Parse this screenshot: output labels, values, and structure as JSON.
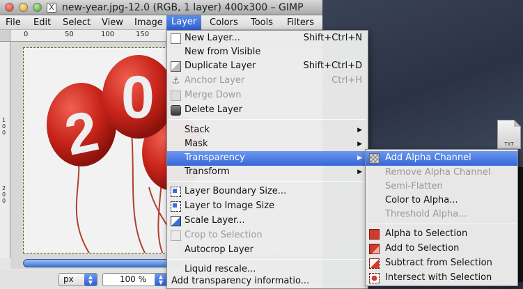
{
  "window": {
    "title": "new-year.jpg-12.0 (RGB, 1 layer) 400x300 – GIMP",
    "x11_badge": "X"
  },
  "menubar": {
    "items": [
      "File",
      "Edit",
      "Select",
      "View",
      "Image",
      "Layer",
      "Colors",
      "Tools",
      "Filters"
    ],
    "active": "Layer"
  },
  "ruler": {
    "h_labels": [
      "0",
      "50",
      "100",
      "150"
    ],
    "v_labels": [
      "1\n0\n0",
      "2\n0\n0"
    ]
  },
  "canvas": {
    "balloon_text": [
      "2",
      "0"
    ],
    "colors": {
      "balloon_red": "#c8241a",
      "balloon_highlight": "#f06050",
      "string": "#b04030",
      "background": "#f2f2f2"
    }
  },
  "statusbar": {
    "unit": "px",
    "zoom": "100 %",
    "message": "Add transparency informatio..."
  },
  "layer_menu": {
    "items": [
      {
        "label": "New Layer...",
        "shortcut": "Shift+Ctrl+N",
        "icon": "new-layer-icon",
        "disabled": false
      },
      {
        "label": "New from Visible",
        "shortcut": "",
        "icon": "",
        "disabled": false
      },
      {
        "label": "Duplicate Layer",
        "shortcut": "Shift+Ctrl+D",
        "icon": "duplicate-icon",
        "disabled": false
      },
      {
        "label": "Anchor Layer",
        "shortcut": "Ctrl+H",
        "icon": "anchor-icon",
        "disabled": true
      },
      {
        "label": "Merge Down",
        "shortcut": "",
        "icon": "merge-down-icon",
        "disabled": true
      },
      {
        "label": "Delete Layer",
        "shortcut": "",
        "icon": "trash-icon",
        "disabled": false
      },
      {
        "label": "Stack",
        "submenu": true
      },
      {
        "label": "Mask",
        "submenu": true
      },
      {
        "label": "Transparency",
        "submenu": true,
        "highlighted": true
      },
      {
        "label": "Transform",
        "submenu": true
      },
      {
        "label": "Layer Boundary Size...",
        "icon": "layer-boundary-icon"
      },
      {
        "label": "Layer to Image Size",
        "icon": "layer-to-image-icon"
      },
      {
        "label": "Scale Layer...",
        "icon": "scale-layer-icon"
      },
      {
        "label": "Crop to Selection",
        "icon": "crop-icon",
        "disabled": true
      },
      {
        "label": "Autocrop Layer",
        "icon": ""
      },
      {
        "label": "Liquid rescale...",
        "icon": ""
      }
    ]
  },
  "transparency_menu": {
    "items": [
      {
        "label": "Add Alpha Channel",
        "icon": "alpha-checker-icon",
        "highlighted": true
      },
      {
        "label": "Remove Alpha Channel",
        "disabled": true
      },
      {
        "label": "Semi-Flatten",
        "disabled": true
      },
      {
        "label": "Color to Alpha...",
        "disabled": false
      },
      {
        "label": "Threshold Alpha...",
        "disabled": true
      },
      {
        "label": "Alpha to Selection",
        "icon": "alpha-to-selection-icon"
      },
      {
        "label": "Add to Selection",
        "icon": "add-to-selection-icon"
      },
      {
        "label": "Subtract from Selection",
        "icon": "subtract-selection-icon"
      },
      {
        "label": "Intersect with Selection",
        "icon": "intersect-selection-icon"
      }
    ]
  },
  "desktop": {
    "file_label": "TXT"
  }
}
